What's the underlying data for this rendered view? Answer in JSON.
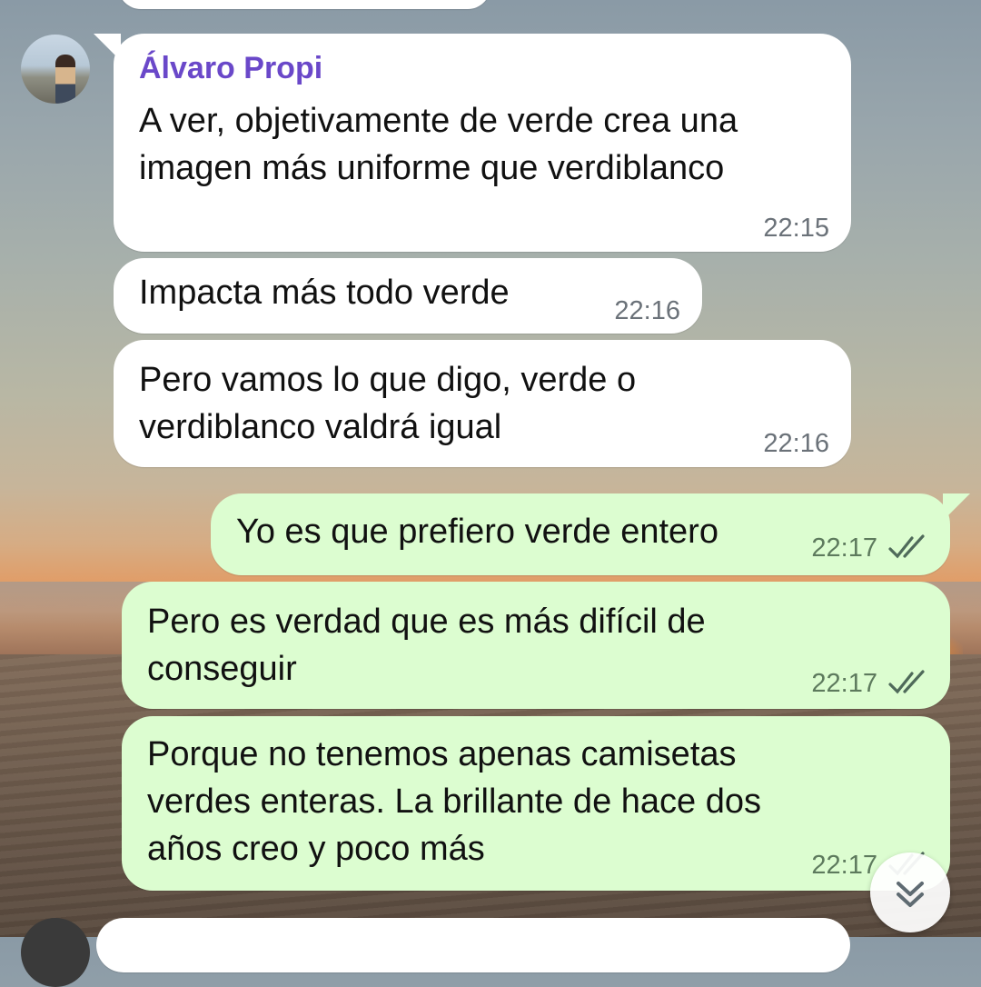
{
  "chat": {
    "messages": [
      {
        "direction": "incoming",
        "sender": "Álvaro Propi",
        "text": "A ver, objetivamente de verde crea una\nimagen más uniforme que verdiblanco",
        "time": "22:15"
      },
      {
        "direction": "incoming",
        "text": "Impacta más todo verde",
        "time": "22:16"
      },
      {
        "direction": "incoming",
        "text": "Pero vamos lo que digo, verde o\nverdiblanco valdrá igual",
        "time": "22:16"
      },
      {
        "direction": "outgoing",
        "text": "Yo es que prefiero verde entero",
        "time": "22:17",
        "status": "read"
      },
      {
        "direction": "outgoing",
        "text": "Pero es verdad que es más difícil de\nconseguir",
        "time": "22:17",
        "status": "read"
      },
      {
        "direction": "outgoing",
        "text": "Porque no tenemos apenas camisetas\nverdes enteras. La brillante de hace dos\naños creo y poco más",
        "time": "22:17",
        "status": "read"
      }
    ]
  },
  "icons": {
    "read_receipt": "double-check-icon",
    "scroll_down": "double-chevron-down-icon"
  },
  "colors": {
    "incoming_bubble": "#ffffff",
    "outgoing_bubble": "#dcfdd0",
    "sender_name": "#6a48c9",
    "timestamp": "#6b7279"
  }
}
